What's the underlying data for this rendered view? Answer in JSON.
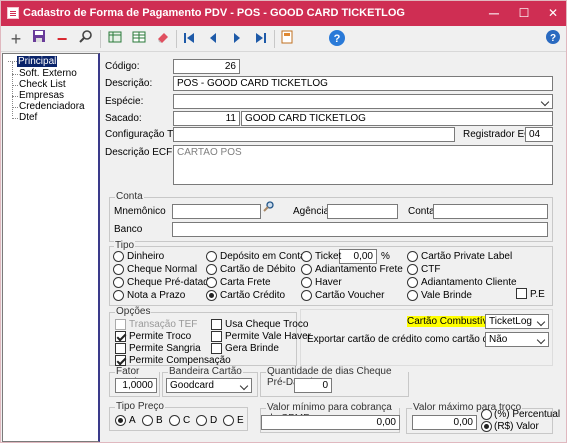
{
  "window": {
    "title": "Cadastro de Forma de Pagamento PDV - POS - GOOD CARD TICKETLOG",
    "min": "─",
    "max": "☐",
    "close": "✕"
  },
  "toolbar": {
    "add": "+",
    "save": "💾",
    "remove": "−",
    "search": "🔍",
    "tool5": "▦",
    "tool6": "▦",
    "tool7": "▤",
    "tool8": "✎",
    "first": "⏮",
    "prev": "◀",
    "next": "▶",
    "last": "⏭",
    "tool13": "▤",
    "help": "?",
    "help2": "?"
  },
  "tree": {
    "root": "Principal",
    "items": [
      "Soft. Externo",
      "Check List",
      "Empresas",
      "Credenciadora",
      "Dtef"
    ]
  },
  "form": {
    "codigo_label": "Código:",
    "codigo": "26",
    "descricao_label": "Descrição:",
    "descricao": "POS - GOOD CARD TICKETLOG",
    "especie_label": "Espécie:",
    "especie": "",
    "sacado_label": "Sacado:",
    "sacado_code": "11",
    "sacado_name": "GOOD CARD TICKETLOG",
    "tef_label": "Configuração TEF:",
    "tef": "",
    "registrador_label": "Registrador ECF",
    "registrador": "04",
    "desc_ecf_label": "Descrição ECF:",
    "desc_ecf": "CARTAO POS"
  },
  "conta": {
    "title": "Conta",
    "mnemonico_label": "Mnemônico",
    "mnemonico": "",
    "agencia_label": "Agência",
    "agencia": "",
    "conta_label": "Conta",
    "conta": "",
    "banco_label": "Banco",
    "banco": ""
  },
  "tipo": {
    "title": "Tipo",
    "options": [
      "Dinheiro",
      "Cheque Normal",
      "Cheque Pré-datado",
      "Nota a Prazo",
      "Depósito em Conta",
      "Cartão de Débito",
      "Carta Frete",
      "Cartão Crédito",
      "Ticket",
      "Adiantamento Frete",
      "Haver",
      "Cartão Voucher",
      "Cartão Private Label",
      "CTF",
      "Adiantamento Cliente",
      "Vale Brinde"
    ],
    "selected": "Cartão Crédito",
    "ticket_value": "0,00",
    "ticket_unit": "%",
    "pe_label": "P.E"
  },
  "opcoes": {
    "title": "Opções",
    "items": [
      {
        "label": "Transação TEF",
        "checked": false,
        "disabled": true
      },
      {
        "label": "Permite Troco",
        "checked": true,
        "disabled": false
      },
      {
        "label": "Permite Sangria",
        "checked": false,
        "disabled": false
      },
      {
        "label": "Permite Compensação",
        "checked": true,
        "disabled": false
      },
      {
        "label": "Usa Cheque Troco",
        "checked": false,
        "disabled": false
      },
      {
        "label": "Permite Vale Haver",
        "checked": false,
        "disabled": false
      },
      {
        "label": "Gera Brinde",
        "checked": false,
        "disabled": false
      }
    ]
  },
  "combustivel": {
    "label": "Cartão Combustível:",
    "value": "TicketLog",
    "export_label": "Exportar cartão de crédito como cartão de débito:",
    "export_value": "Não"
  },
  "fator": {
    "title": "Fator Reaj.",
    "value": "1,0000"
  },
  "bandeira": {
    "title": "Bandeira Cartão",
    "value": "Goodcard"
  },
  "dias": {
    "title": "Quantidade de dias Cheque Pré-Datado",
    "value": "0"
  },
  "preco": {
    "title": "Tipo Preço",
    "options": [
      "A",
      "B",
      "C",
      "D",
      "E"
    ],
    "selected": "A"
  },
  "cpmf": {
    "title": "Valor mínimo para cobrança de CPMF",
    "value": "0,00"
  },
  "troco": {
    "title": "Valor máximo para troco",
    "value": "0,00",
    "opt1": "(%) Percentual",
    "opt2": "(R$) Valor",
    "selected": "(R$) Valor"
  },
  "colors": {
    "titlebar": "#cf2e53",
    "highlight": "#ffff00",
    "selection": "#0a246a"
  }
}
